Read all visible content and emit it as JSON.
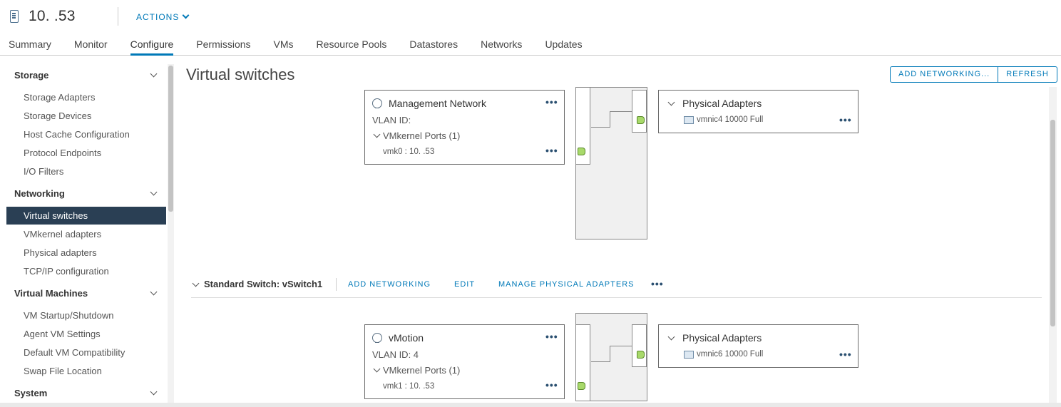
{
  "header": {
    "host_title": "10.         .53",
    "actions_label": "ACTIONS",
    "tabs": [
      "Summary",
      "Monitor",
      "Configure",
      "Permissions",
      "VMs",
      "Resource Pools",
      "Datastores",
      "Networks",
      "Updates"
    ],
    "active_tab": "Configure"
  },
  "sidebar": {
    "storage": {
      "label": "Storage",
      "items": [
        "Storage Adapters",
        "Storage Devices",
        "Host Cache Configuration",
        "Protocol Endpoints",
        "I/O Filters"
      ]
    },
    "networking": {
      "label": "Networking",
      "items": [
        "Virtual switches",
        "VMkernel adapters",
        "Physical adapters",
        "TCP/IP configuration"
      ]
    },
    "virtual_machines": {
      "label": "Virtual Machines",
      "items": [
        "VM Startup/Shutdown",
        "Agent VM Settings",
        "Default VM Compatibility",
        "Swap File Location"
      ]
    },
    "system": {
      "label": "System"
    }
  },
  "main": {
    "title": "Virtual switches",
    "add_networking_btn": "ADD NETWORKING...",
    "refresh_btn": "REFRESH",
    "switch0": {
      "portgroup_name": "Management Network",
      "vlan": "VLAN ID:",
      "vmk_ports": "VMkernel Ports (1)",
      "vmk": "vmk0 : 10.          .53",
      "phys_title": "Physical Adapters",
      "nic": "vmnic4 10000 Full"
    },
    "switch1": {
      "header": "Standard Switch: vSwitch1",
      "add_networking": "ADD NETWORKING",
      "edit": "EDIT",
      "manage_adapters": "MANAGE PHYSICAL ADAPTERS",
      "portgroup_name": "vMotion",
      "vlan": "VLAN ID: 4",
      "vmk_ports": "VMkernel Ports (1)",
      "vmk": "vmk1 : 10.          .53",
      "phys_title": "Physical Adapters",
      "nic": "vmnic6 10000 Full"
    },
    "more": "•••"
  }
}
